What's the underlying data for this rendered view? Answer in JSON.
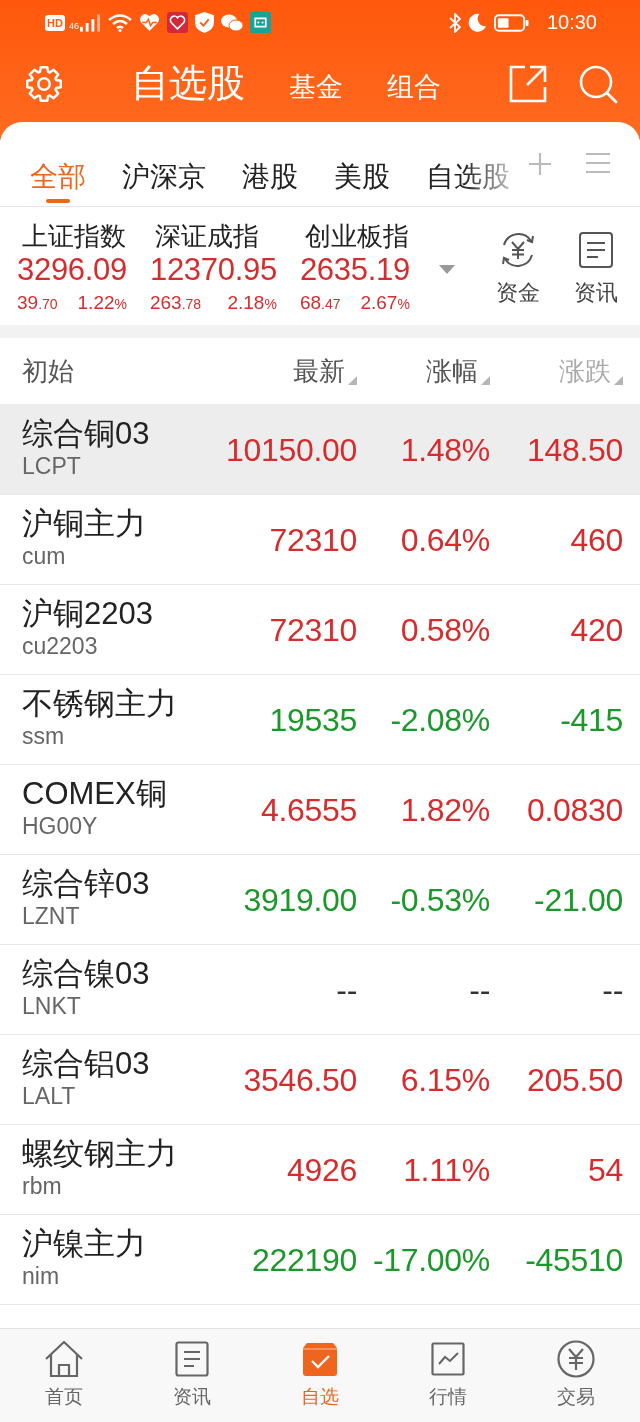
{
  "status_bar": {
    "hd_badge": "HD",
    "network_type": "46",
    "time": "10:30"
  },
  "header": {
    "tabs": [
      {
        "label": "自选股",
        "selected": true
      },
      {
        "label": "基金",
        "selected": false
      },
      {
        "label": "组合",
        "selected": false
      }
    ]
  },
  "market_tabs": [
    {
      "label": "全部",
      "selected": true
    },
    {
      "label": "沪深京",
      "selected": false
    },
    {
      "label": "港股",
      "selected": false
    },
    {
      "label": "美股",
      "selected": false
    },
    {
      "label": "自选股",
      "selected": false
    }
  ],
  "indices": [
    {
      "name": "上证指数",
      "value": "3296.09",
      "change": "39.70",
      "percent": "1.22%",
      "color": "#d52d2d"
    },
    {
      "name": "深证成指",
      "value": "12370.95",
      "change": "263.78",
      "percent": "2.18%",
      "color": "#d52d2d"
    },
    {
      "name": "创业板指",
      "value": "2635.19",
      "change": "68.47",
      "percent": "2.67%",
      "color": "#d52d2d"
    }
  ],
  "index_actions": [
    {
      "kind": "funds",
      "label": "资金"
    },
    {
      "kind": "news",
      "label": "资讯"
    }
  ],
  "table": {
    "columns": [
      {
        "label": "初始",
        "sortable": false
      },
      {
        "label": "最新",
        "sortable": true
      },
      {
        "label": "涨幅",
        "sortable": true
      },
      {
        "label": "涨跌",
        "sortable": true
      }
    ],
    "rows": [
      {
        "name": "综合铜03",
        "code": "LCPT",
        "latest": "10150.00",
        "percent": "1.48%",
        "change": "148.50",
        "color": "#d52d2d",
        "selected": true
      },
      {
        "name": "沪铜主力",
        "code": "cum",
        "latest": "72310",
        "percent": "0.64%",
        "change": "460",
        "color": "#d52d2d",
        "selected": false
      },
      {
        "name": "沪铜2203",
        "code": "cu2203",
        "latest": "72310",
        "percent": "0.58%",
        "change": "420",
        "color": "#d52d2d",
        "selected": false
      },
      {
        "name": "不锈钢主力",
        "code": "ssm",
        "latest": "19535",
        "percent": "-2.08%",
        "change": "-415",
        "color": "#1b982a",
        "selected": false
      },
      {
        "name": "COMEX铜",
        "code": "HG00Y",
        "latest": "4.6555",
        "percent": "1.82%",
        "change": "0.0830",
        "color": "#d52d2d",
        "selected": false
      },
      {
        "name": "综合锌03",
        "code": "LZNT",
        "latest": "3919.00",
        "percent": "-0.53%",
        "change": "-21.00",
        "color": "#1b982a",
        "selected": false
      },
      {
        "name": "综合镍03",
        "code": "LNKT",
        "latest": "--",
        "percent": "--",
        "change": "--",
        "color": "#333333",
        "selected": false
      },
      {
        "name": "综合铝03",
        "code": "LALT",
        "latest": "3546.50",
        "percent": "6.15%",
        "change": "205.50",
        "color": "#d52d2d",
        "selected": false
      },
      {
        "name": "螺纹钢主力",
        "code": "rbm",
        "latest": "4926",
        "percent": "1.11%",
        "change": "54",
        "color": "#d52d2d",
        "selected": false
      },
      {
        "name": "沪镍主力",
        "code": "nim",
        "latest": "222190",
        "percent": "-17.00%",
        "change": "-45510",
        "color": "#1b982a",
        "selected": false
      }
    ]
  },
  "bottom_nav": [
    {
      "kind": "home",
      "label": "首页",
      "selected": false
    },
    {
      "kind": "news",
      "label": "资讯",
      "selected": false
    },
    {
      "kind": "watchlist",
      "label": "自选",
      "selected": true
    },
    {
      "kind": "market",
      "label": "行情",
      "selected": false
    },
    {
      "kind": "trade",
      "label": "交易",
      "selected": false
    }
  ]
}
